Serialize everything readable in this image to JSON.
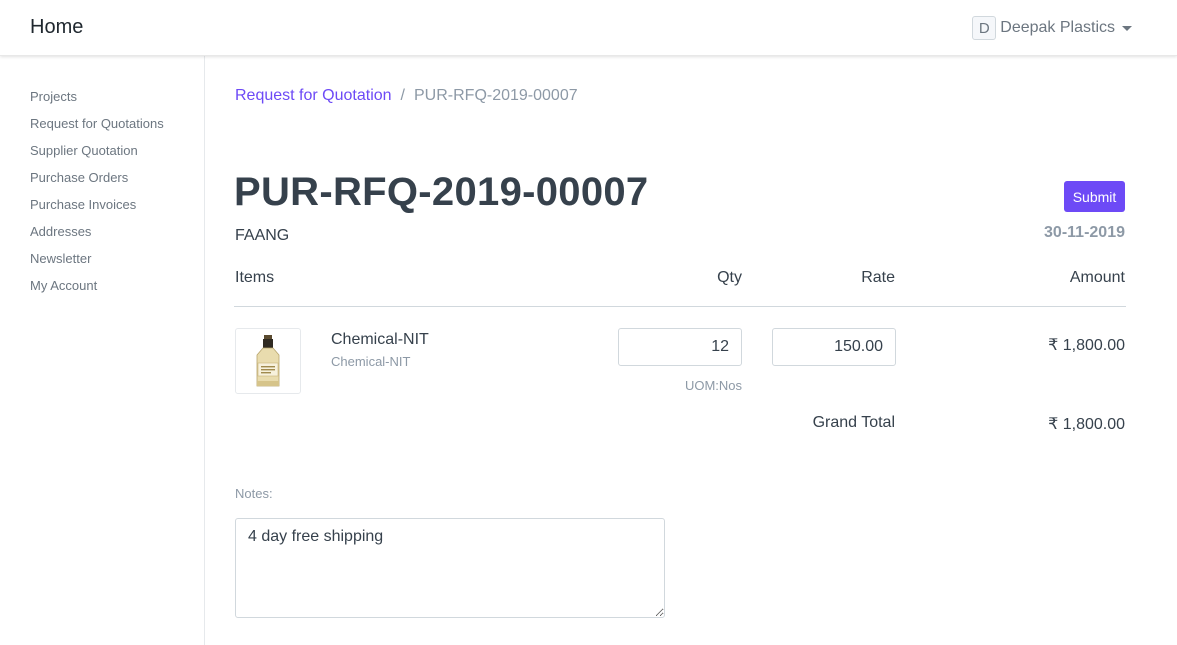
{
  "navbar": {
    "brand": "Home",
    "user_initial": "D",
    "user_name": "Deepak Plastics"
  },
  "sidebar": {
    "items": [
      {
        "label": "Projects"
      },
      {
        "label": "Request for Quotations"
      },
      {
        "label": "Supplier Quotation"
      },
      {
        "label": "Purchase Orders"
      },
      {
        "label": "Purchase Invoices"
      },
      {
        "label": "Addresses"
      },
      {
        "label": "Newsletter"
      },
      {
        "label": "My Account"
      }
    ]
  },
  "breadcrumb": {
    "parent": "Request for Quotation",
    "separator": "/",
    "current": "PUR-RFQ-2019-00007"
  },
  "doc": {
    "title": "PUR-RFQ-2019-00007",
    "submit_label": "Submit",
    "supplier": "FAANG",
    "date": "30-11-2019"
  },
  "table": {
    "headers": {
      "items": "Items",
      "qty": "Qty",
      "rate": "Rate",
      "amount": "Amount"
    },
    "rows": [
      {
        "name": "Chemical-NIT",
        "code": "Chemical-NIT",
        "qty": "12",
        "rate": "150.00",
        "uom": "UOM:Nos",
        "amount": "₹ 1,800.00",
        "image_icon": "bottle-icon"
      }
    ],
    "grand_total_label": "Grand Total",
    "grand_total_value": "₹ 1,800.00"
  },
  "notes": {
    "label": "Notes:",
    "value": "4 day free shipping"
  },
  "colors": {
    "accent": "#6d4af6",
    "text": "#36414c",
    "muted": "#8d99a6",
    "border": "#d1d8dd"
  }
}
